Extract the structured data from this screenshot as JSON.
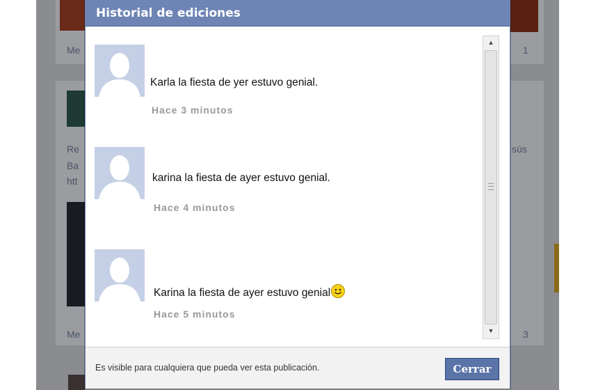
{
  "background": {
    "left_labels": [
      "Me",
      "Re",
      "Ba",
      "htt",
      "Me"
    ],
    "right_labels": [
      "1",
      "sús",
      "3"
    ]
  },
  "modal": {
    "title": "Historial de ediciones",
    "entries": [
      {
        "text": "Karla la fiesta de yer estuvo genial.",
        "time": "Hace 3 minutos",
        "has_smiley": false
      },
      {
        "text": "karina la fiesta de ayer estuvo genial.",
        "time": "Hace 4 minutos",
        "has_smiley": false
      },
      {
        "text": "Karina la fiesta de ayer estuvo genial",
        "time": "Hace 5 minutos",
        "has_smiley": true
      }
    ],
    "footer_note": "Es visible para cualquiera que pueda ver esta publicación.",
    "close_label": "Cerrar"
  },
  "colors": {
    "header": "#6d84b4",
    "button": "#5b74a8",
    "avatar": "#c5d0e6"
  },
  "icons": [
    "default-avatar-icon",
    "smiley-icon",
    "scroll-up-icon",
    "scroll-down-icon"
  ]
}
